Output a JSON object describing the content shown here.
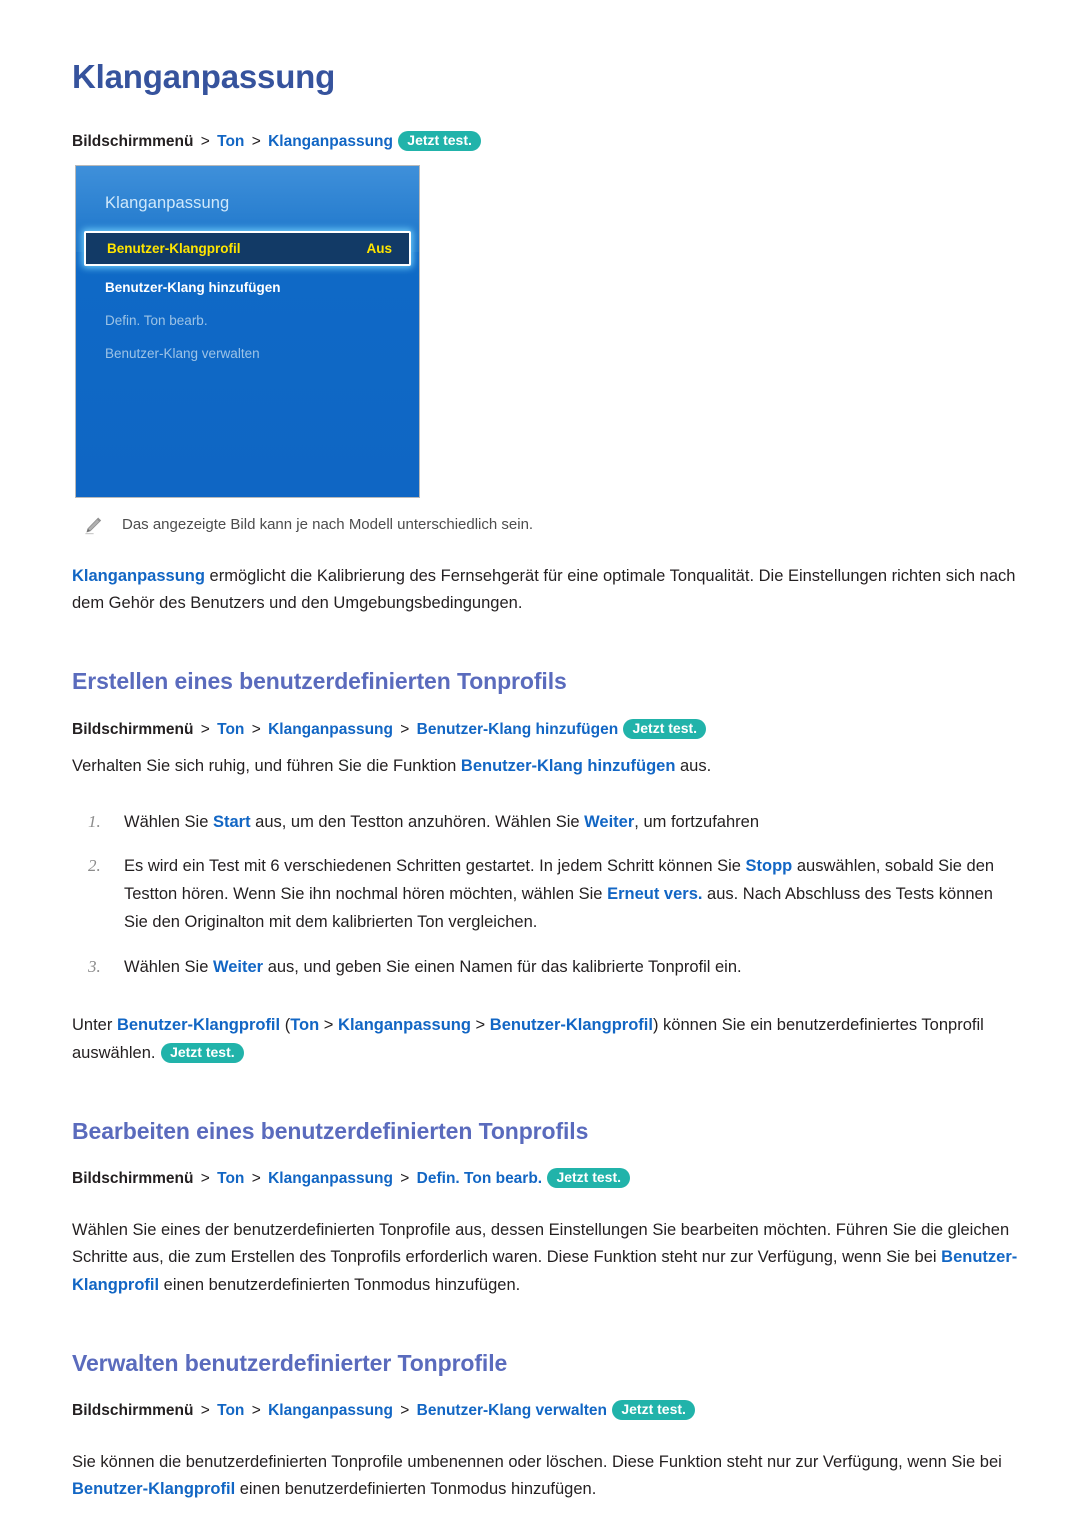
{
  "document": {
    "title": "Klanganpassung"
  },
  "breadcrumbs": {
    "main": {
      "root": "Bildschirmmenü",
      "sep": ">",
      "items": [
        "Ton",
        "Klanganpassung"
      ],
      "badge": "Jetzt test."
    },
    "create": {
      "root": "Bildschirmmenü",
      "sep": ">",
      "items": [
        "Ton",
        "Klanganpassung",
        "Benutzer-Klang hinzufügen"
      ],
      "badge": "Jetzt test."
    },
    "edit": {
      "root": "Bildschirmmenü",
      "sep": ">",
      "items": [
        "Ton",
        "Klanganpassung",
        "Defin. Ton bearb."
      ],
      "badge": "Jetzt test."
    },
    "manage": {
      "root": "Bildschirmmenü",
      "sep": ">",
      "items": [
        "Ton",
        "Klanganpassung",
        "Benutzer-Klang verwalten"
      ],
      "badge": "Jetzt test."
    }
  },
  "tv_screenshot": {
    "menu_title": "Klanganpassung",
    "rows": [
      {
        "label": "Benutzer-Klangprofil",
        "value": "Aus",
        "state": "selected"
      },
      {
        "label": "Benutzer-Klang hinzufügen",
        "value": "",
        "state": "active"
      },
      {
        "label": "Defin. Ton bearb.",
        "value": "",
        "state": "dim"
      },
      {
        "label": "Benutzer-Klang verwalten",
        "value": "",
        "state": "dim"
      }
    ],
    "colors": {
      "panel_blue": "#0f69c6",
      "selected_row_bg": "#123a66",
      "selected_text": "#ffe500",
      "title_text": "#cfe8fb",
      "dim_text": "#9dc3e6"
    }
  },
  "note": {
    "icon": "pencil-icon",
    "text": "Das angezeigte Bild kann je nach Modell unterschiedlich sein."
  },
  "intro": {
    "term": "Klanganpassung",
    "text": " ermöglicht die Kalibrierung des Fernsehgerät für eine optimale Tonqualität. Die Einstellungen richten sich nach dem Gehör des Benutzers und den Umgebungsbedingungen."
  },
  "sections": {
    "create": {
      "heading": "Erstellen eines benutzerdefinierten Tonprofils",
      "lead_before": "Verhalten Sie sich ruhig, und führen Sie die Funktion ",
      "lead_term": "Benutzer-Klang hinzufügen",
      "lead_after": " aus.",
      "steps": [
        {
          "p1": "Wählen Sie ",
          "t1": "Start",
          "p2": " aus, um den Testton anzuhören. Wählen Sie ",
          "t2": "Weiter",
          "p3": ", um fortzufahren"
        },
        {
          "p1": "Es wird ein Test mit 6 verschiedenen Schritten gestartet. In jedem Schritt können Sie ",
          "t1": "Stopp",
          "p2": " auswählen, sobald Sie den Testton hören. Wenn Sie ihn nochmal hören möchten, wählen Sie ",
          "t2": "Erneut vers.",
          "p3": " aus. Nach Abschluss des Tests können Sie den Originalton mit dem kalibrierten Ton vergleichen."
        },
        {
          "p1": "Wählen Sie ",
          "t1": "Weiter",
          "p2": " aus, und geben Sie einen Namen für das kalibrierte Tonprofil ein.",
          "t2": "",
          "p3": ""
        }
      ],
      "closing": {
        "pre": "Unter ",
        "term1": "Benutzer-Klangprofil",
        "paren_open": " (",
        "term2": "Ton",
        "sep": " > ",
        "term3": "Klanganpassung",
        "term4": "Benutzer-Klangprofil",
        "paren_close": ") ",
        "post": "können Sie ein benutzerdefiniertes Tonprofil auswählen. ",
        "badge": "Jetzt test."
      }
    },
    "edit": {
      "heading": "Bearbeiten eines benutzerdefinierten Tonprofils",
      "body_before": "Wählen Sie eines der benutzerdefinierten Tonprofile aus, dessen Einstellungen Sie bearbeiten möchten. Führen Sie die gleichen Schritte aus, die zum Erstellen des Tonprofils erforderlich waren. Diese Funktion steht nur zur Verfügung, wenn Sie bei ",
      "body_term": "Benutzer-Klangprofil",
      "body_after": " einen benutzerdefinierten Tonmodus hinzufügen."
    },
    "manage": {
      "heading": "Verwalten benutzerdefinierter Tonprofile",
      "body_before": "Sie können die benutzerdefinierten Tonprofile umbenennen oder löschen. Diese Funktion steht nur zur Verfügung, wenn Sie bei ",
      "body_term": "Benutzer-Klangprofil",
      "body_after": " einen benutzerdefinierten Tonmodus hinzufügen."
    }
  }
}
